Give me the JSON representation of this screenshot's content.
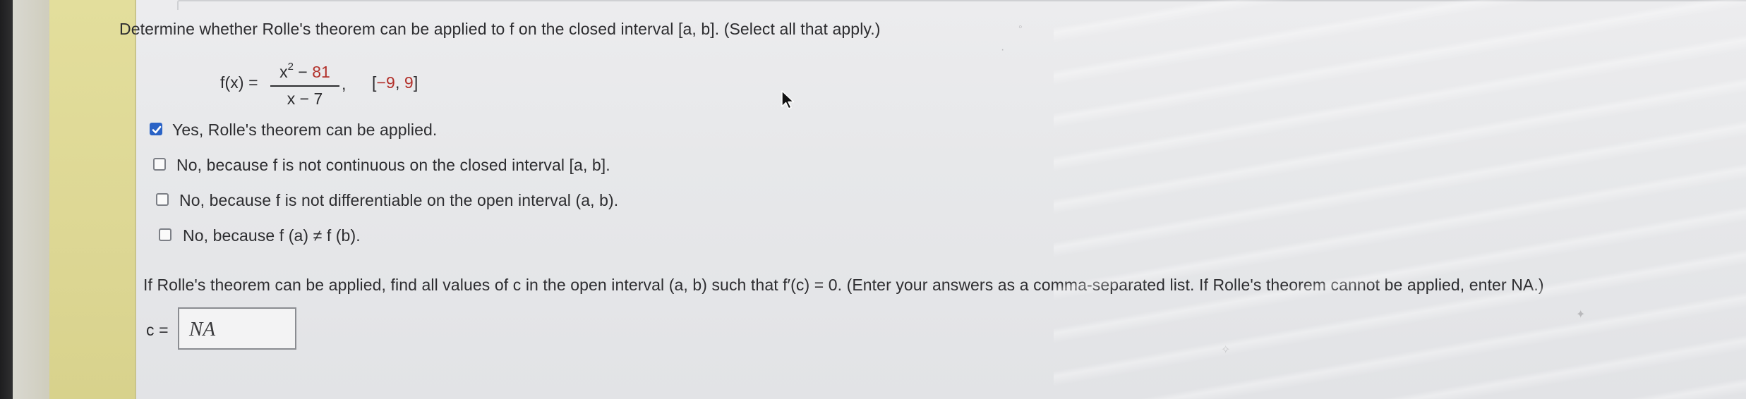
{
  "question": {
    "prompt": "Determine whether Rolle's theorem can be applied to f on the closed interval [a, b]. (Select all that apply.)",
    "function": {
      "lhs": "f(x) =",
      "numerator_x": "x",
      "numerator_exp": "2",
      "numerator_op": " − ",
      "numerator_const": "81",
      "denominator": "x − 7",
      "interval_open": "[",
      "interval_a": "−9",
      "interval_sep": ", ",
      "interval_b": "9",
      "interval_close": "]"
    },
    "options": [
      {
        "label": "Yes, Rolle's theorem can be applied.",
        "checked": true
      },
      {
        "label": "No, because f is not continuous on the closed interval [a, b].",
        "checked": false
      },
      {
        "label": "No, because f is not differentiable on the open interval (a, b).",
        "checked": false
      },
      {
        "label": "No, because f (a) ≠ f (b).",
        "checked": false
      }
    ],
    "followup": "If Rolle's theorem can be applied, find all values of c in the open interval (a, b) such that f′(c) = 0. (Enter your answers as a comma-separated list. If Rolle's theorem cannot be applied, enter NA.)",
    "answer_label": "c =",
    "answer_value": "NA"
  },
  "colors": {
    "accent_red": "#b2302a",
    "checkbox_blue": "#2a63c6",
    "sidebar_yellow": "#e3de9c"
  },
  "icons": {
    "cursor": "arrow-cursor-icon",
    "check": "checkmark-icon"
  }
}
